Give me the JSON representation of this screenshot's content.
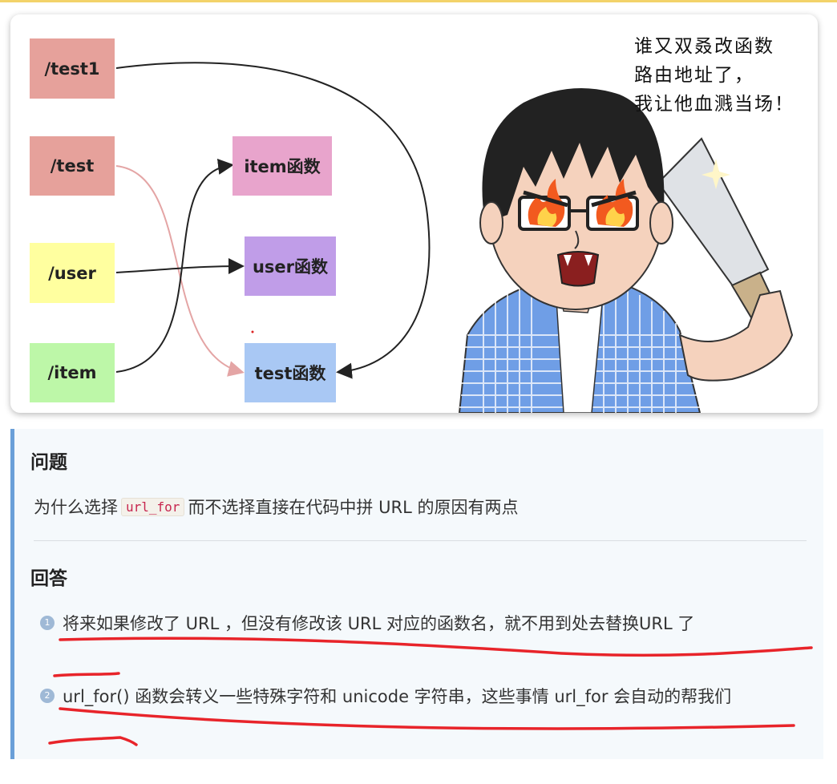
{
  "diagram": {
    "routes": [
      "/test1",
      "/test",
      "/user",
      "/item"
    ],
    "functions": [
      "item函数",
      "user函数",
      "test函数"
    ],
    "colors": {
      "test1": "#e6a19b",
      "test": "#e6a19b",
      "user": "#ffff9f",
      "item": "#bdf7a8",
      "item_func": "#e8a4cc",
      "user_func": "#c09de8",
      "test_func": "#a9c8f4",
      "pink_arrow": "#e4a5a5",
      "black_arrow": "#222222"
    },
    "speech": [
      "谁又双叒改函数",
      "路由地址了，",
      "我让他血溅当场！"
    ]
  },
  "qa": {
    "question_heading": "问题",
    "question_prefix": "为什么选择",
    "question_code": "url_for",
    "question_suffix": "而不选择直接在代码中拼 URL 的原因有两点",
    "answer_heading": "回答",
    "answers": [
      {
        "num": "1",
        "text": "将来如果修改了 URL ，但没有修改该 URL  对应的函数名，就不用到处去替换URL 了"
      },
      {
        "num": "2",
        "text": "url_for()  函数会转义一些特殊字符和 unicode  字符串，这些事情 url_for  会自动的帮我们"
      }
    ],
    "accent": "#6a9fd8",
    "underline_color": "#e8242a"
  }
}
